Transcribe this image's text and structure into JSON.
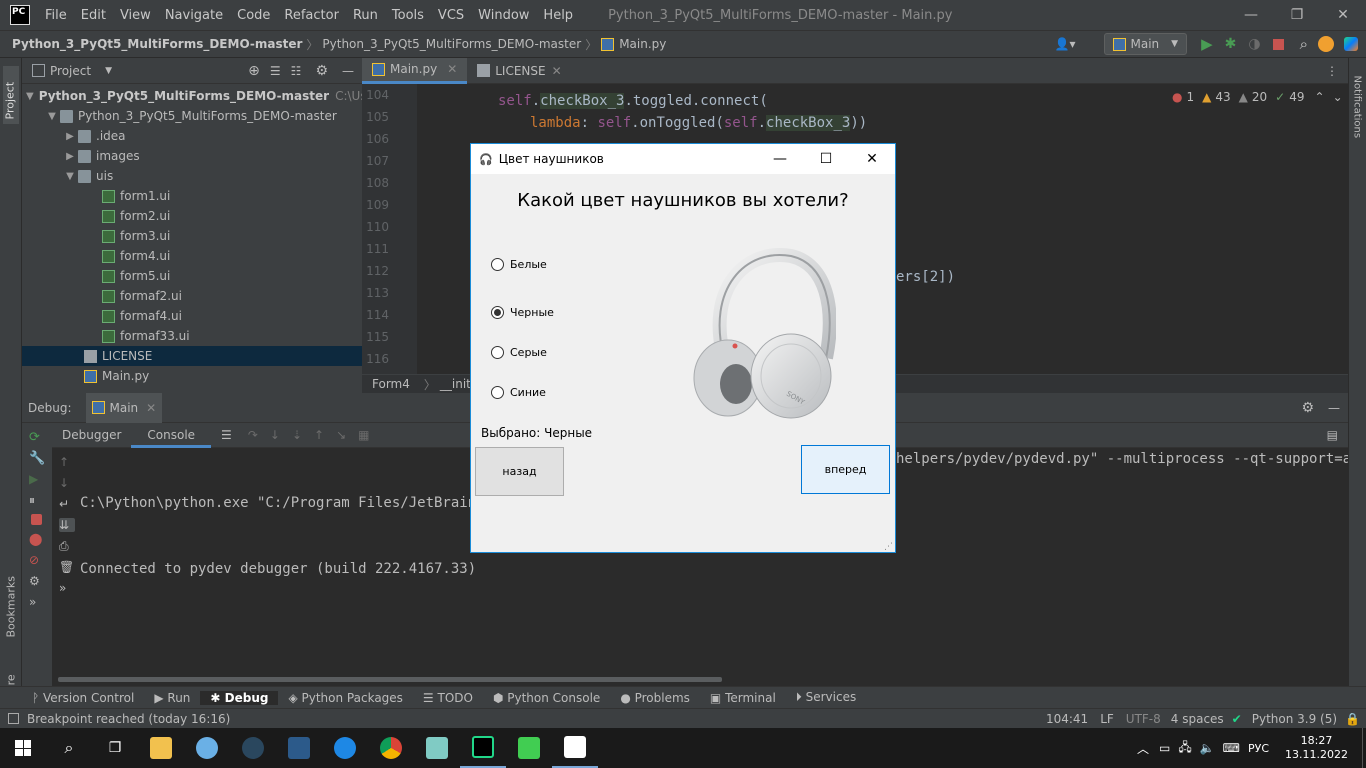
{
  "menubar": {
    "items": [
      "File",
      "Edit",
      "View",
      "Navigate",
      "Code",
      "Refactor",
      "Run",
      "Tools",
      "VCS",
      "Window",
      "Help"
    ],
    "window_title": "Python_3_PyQt5_MultiForms_DEMO-master - Main.py"
  },
  "navbar": {
    "crumbs": [
      "Python_3_PyQt5_MultiForms_DEMO-master",
      "Python_3_PyQt5_MultiForms_DEMO-master",
      "Main.py"
    ],
    "run_config": "Main"
  },
  "left_strip": {
    "project": "Project",
    "bookmarks": "Bookmarks",
    "structure": "Structure"
  },
  "right_strip": {
    "notifications": "Notifications"
  },
  "project_panel": {
    "title": "Project",
    "root": "Python_3_PyQt5_MultiForms_DEMO-master",
    "root_path": "C:\\Users\\",
    "sub": "Python_3_PyQt5_MultiForms_DEMO-master",
    "folders": [
      ".idea",
      "images",
      "uis"
    ],
    "ui_files": [
      "form1.ui",
      "form2.ui",
      "form3.ui",
      "form4.ui",
      "form5.ui",
      "formaf2.ui",
      "formaf4.ui",
      "formaf33.ui"
    ],
    "files": [
      "LICENSE",
      "Main.py"
    ]
  },
  "editor": {
    "tabs": [
      "Main.py",
      "LICENSE"
    ],
    "line_numbers": [
      "104",
      "105",
      "106",
      "107",
      "108",
      "109",
      "110",
      "111",
      "112",
      "113",
      "114",
      "115",
      "116"
    ],
    "code_line_1": {
      "self": "self",
      ".": ".",
      "attr": "checkBox_3",
      ".toggled.connect(": ".toggled.connect("
    },
    "code_line_2": {
      "lambda": "lambda",
      ": ": ": ",
      "self": "self",
      ".onToggled(": ".onToggled(",
      "self2": "self",
      ".": ".",
      "attr": "checkBox_3",
      "end": "))"
    },
    "code_tail": "ers[2])",
    "inspections": {
      "errors": "1",
      "warnings": "43",
      "weak": "20",
      "ok": "49"
    },
    "breadcrumb": [
      "Form4",
      "__init__"
    ]
  },
  "debug": {
    "label": "Debug:",
    "session": "Main",
    "tabs": [
      "Debugger",
      "Console"
    ],
    "console_lines": [
      "C:\\Python\\python.exe \"C:/Program Files/JetBrains/",
      "Connected to pydev debugger (build 222.4167.33)"
    ],
    "console_tail": "helpers/pydev/pydevd.py\" --multiprocess --qt-support=aut"
  },
  "bottom_tabs": [
    "Version Control",
    "Run",
    "Debug",
    "Python Packages",
    "TODO",
    "Python Console",
    "Problems",
    "Terminal",
    "Services"
  ],
  "statusbar": {
    "message": "Breakpoint reached (today 16:16)",
    "position": "104:41",
    "line_sep": "LF",
    "encoding": "UTF-8",
    "indent": "4 spaces",
    "interpreter": "Python 3.9 (5)"
  },
  "taskbar": {
    "lang": "РУС",
    "time": "18:27",
    "date": "13.11.2022"
  },
  "dialog": {
    "title": "Цвет наушников",
    "heading": "Какой цвет наушников вы хотели?",
    "options": [
      "Белые",
      "Черные",
      "Серые",
      "Синие"
    ],
    "selected_option": "Черные",
    "selected_text": "Выбрано: Черные",
    "back_button": "назад",
    "forward_button": "вперед",
    "headphones_brand": "SONY"
  },
  "colors": {
    "accent": "#4a88c7",
    "dialog_border": "#1a8cd8",
    "selection": "#0d293e"
  }
}
